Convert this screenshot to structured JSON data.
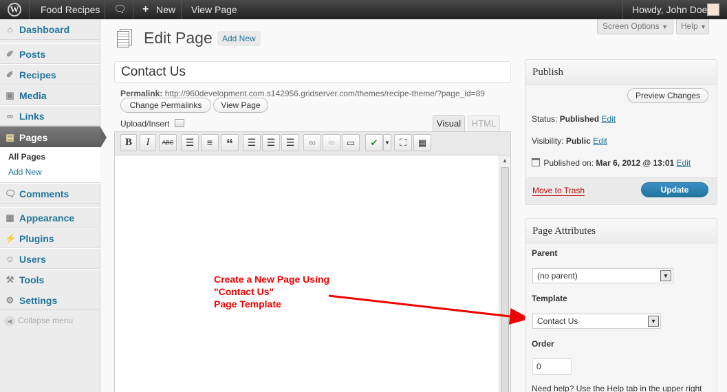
{
  "adminbar": {
    "site": "Food Recipes",
    "new": "New",
    "view": "View Page",
    "howdy": "Howdy, John Doe"
  },
  "sidebar": {
    "dashboard": "Dashboard",
    "posts": "Posts",
    "recipes": "Recipes",
    "media": "Media",
    "links": "Links",
    "pages": "Pages",
    "all_pages": "All Pages",
    "add_new": "Add New",
    "comments": "Comments",
    "appearance": "Appearance",
    "plugins": "Plugins",
    "users": "Users",
    "tools": "Tools",
    "settings": "Settings",
    "collapse": "Collapse menu"
  },
  "header": {
    "title": "Edit Page",
    "add_new": "Add New",
    "screen_options": "Screen Options",
    "help": "Help"
  },
  "editor": {
    "title_value": "Contact Us",
    "permalink_label": "Permalink:",
    "permalink_url": "http://960development.com.s142956.gridserver.com/themes/recipe-theme/?page_id=89",
    "change_permalinks": "Change Permalinks",
    "view_page": "View Page",
    "upload_insert": "Upload/Insert",
    "tab_visual": "Visual",
    "tab_html": "HTML",
    "bold": "B",
    "italic": "I",
    "strike": "ABC",
    "quote": "“"
  },
  "publish": {
    "title": "Publish",
    "preview": "Preview Changes",
    "status_label": "Status:",
    "status_value": "Published",
    "visibility_label": "Visibility:",
    "visibility_value": "Public",
    "published_label": "Published on:",
    "published_value": "Mar 6, 2012 @ 13:01",
    "edit": "Edit",
    "trash": "Move to Trash",
    "update": "Update"
  },
  "attributes": {
    "title": "Page Attributes",
    "parent_label": "Parent",
    "parent_value": "(no parent)",
    "template_label": "Template",
    "template_value": "Contact Us",
    "order_label": "Order",
    "order_value": "0",
    "help": "Need help? Use the Help tab in the upper right"
  },
  "annotation": {
    "line1": "Create a New Page Using",
    "line2": "\"Contact Us\"",
    "line3": "Page Template"
  },
  "colors": {
    "accent": "#21759b",
    "annotation": "#ee0000",
    "update_button": "#2e7fb5"
  }
}
